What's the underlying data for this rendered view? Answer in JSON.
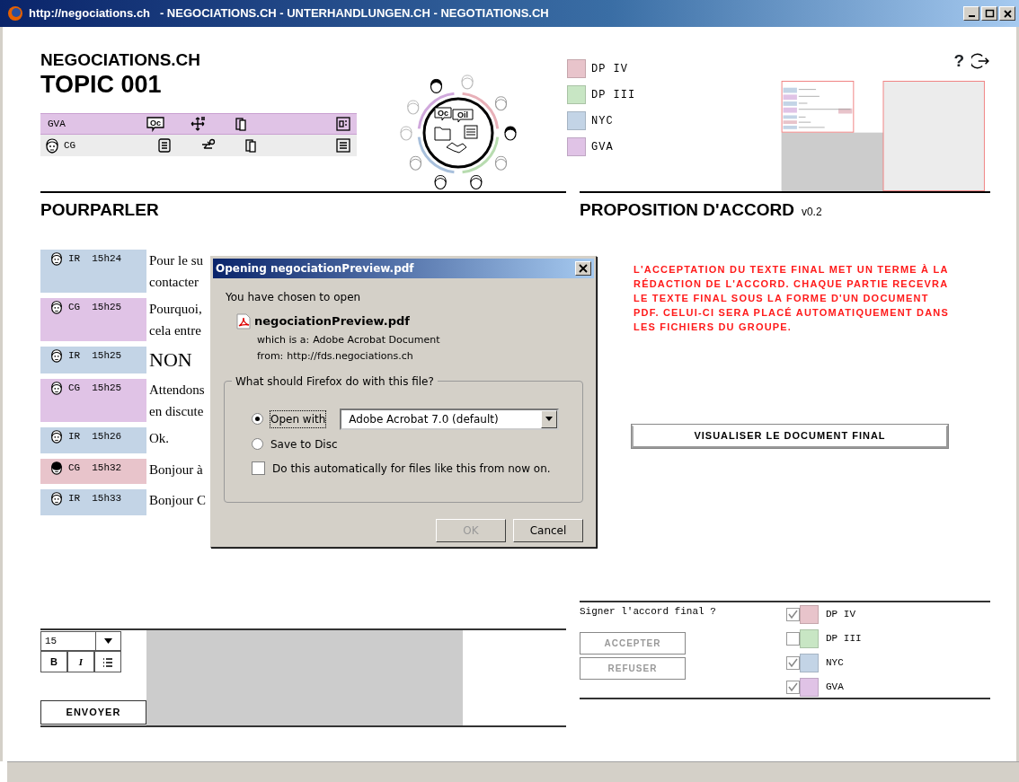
{
  "window": {
    "url": "http://negociations.ch",
    "title": "- NEGOCIATIONS.CH - UNTERHANDLUNGEN.CH - NEGOTIATIONS.CH"
  },
  "header": {
    "site": "NEGOCIATIONS.CH",
    "topic": "TOPIC 001",
    "help": "?",
    "toolbar_rows": [
      {
        "kind": "group",
        "label": "GVA",
        "color": "#e0c3e6",
        "bubble": "Oc"
      },
      {
        "kind": "user",
        "label": "CG",
        "color": "#ececec"
      }
    ],
    "diagram_labels": [
      "Oc",
      "Oil"
    ]
  },
  "legend": [
    {
      "label": "DP IV",
      "color": "#e8c4cb"
    },
    {
      "label": "DP III",
      "color": "#c8e6c4"
    },
    {
      "label": "NYC",
      "color": "#c3d4e6"
    },
    {
      "label": "GVA",
      "color": "#e0c3e6"
    }
  ],
  "left_panel": {
    "title": "POURPARLER",
    "messages": [
      {
        "author": "IR",
        "time": "15h24",
        "color": "#c3d4e6",
        "dark_avatar": false,
        "large": false,
        "lines": [
          "Pour le su",
          "contacter"
        ]
      },
      {
        "author": "CG",
        "time": "15h25",
        "color": "#e0c3e6",
        "dark_avatar": false,
        "large": false,
        "lines": [
          "Pourquoi,",
          "cela entre"
        ]
      },
      {
        "author": "IR",
        "time": "15h25",
        "color": "#c3d4e6",
        "dark_avatar": false,
        "large": true,
        "lines": [
          "NON"
        ]
      },
      {
        "author": "CG",
        "time": "15h25",
        "color": "#e0c3e6",
        "dark_avatar": false,
        "large": false,
        "lines": [
          "Attendons",
          "en discute"
        ]
      },
      {
        "author": "IR",
        "time": "15h26",
        "color": "#c3d4e6",
        "dark_avatar": false,
        "large": false,
        "lines": [
          "Ok."
        ]
      },
      {
        "author": "CG",
        "time": "15h32",
        "color": "#e8c4cb",
        "dark_avatar": true,
        "large": false,
        "lines": [
          "Bonjour à"
        ]
      },
      {
        "author": "IR",
        "time": "15h33",
        "color": "#c3d4e6",
        "dark_avatar": false,
        "large": false,
        "lines": [
          "Bonjour C"
        ]
      }
    ]
  },
  "right_panel": {
    "title": "PROPOSITION D'ACCORD",
    "version": "v0.2",
    "notice": "L'ACCEPTATION DU TEXTE FINAL MET UN TERME À LA RÉDACTION DE L'ACCORD. CHAQUE PARTIE RECEVRA LE TEXTE FINAL SOUS LA FORME D'UN DOCUMENT PDF. CELUI-CI SERA PLACÉ AUTOMATIQUEMENT DANS LES FICHIERS DU GROUPE.",
    "view_button": "VISUALISER LE DOCUMENT FINAL"
  },
  "composer": {
    "font_size": "15",
    "bold": "B",
    "italic": "I",
    "send": "ENVOYER"
  },
  "signature": {
    "question": "Signer l'accord final ?",
    "buttons": [
      {
        "label": "ACCEPTER",
        "disabled": true
      },
      {
        "label": "REFUSER",
        "disabled": true
      }
    ],
    "parties": [
      {
        "label": "DP IV",
        "color": "#e8c4cb",
        "checked": true
      },
      {
        "label": "DP III",
        "color": "#c8e6c4",
        "checked": false
      },
      {
        "label": "NYC",
        "color": "#c3d4e6",
        "checked": true
      },
      {
        "label": "GVA",
        "color": "#e0c3e6",
        "checked": true
      }
    ]
  },
  "dialog": {
    "title": "Opening negociationPreview.pdf",
    "intro": "You have chosen to open",
    "filename": "negociationPreview.pdf",
    "type_label": "which is a:",
    "type": "Adobe Acrobat Document",
    "from_label": "from:",
    "from": "http://fds.negociations.ch",
    "group_label": "What should Firefox do with this file?",
    "options": [
      {
        "label": "Open with",
        "selected": true
      },
      {
        "label": "Save to Disc",
        "selected": false
      }
    ],
    "app": "Adobe Acrobat 7.0 (default)",
    "auto": {
      "label": "Do this automatically for files like this from now on.",
      "checked": false
    },
    "buttons": [
      {
        "label": "OK",
        "disabled": true
      },
      {
        "label": "Cancel",
        "disabled": false
      }
    ]
  }
}
